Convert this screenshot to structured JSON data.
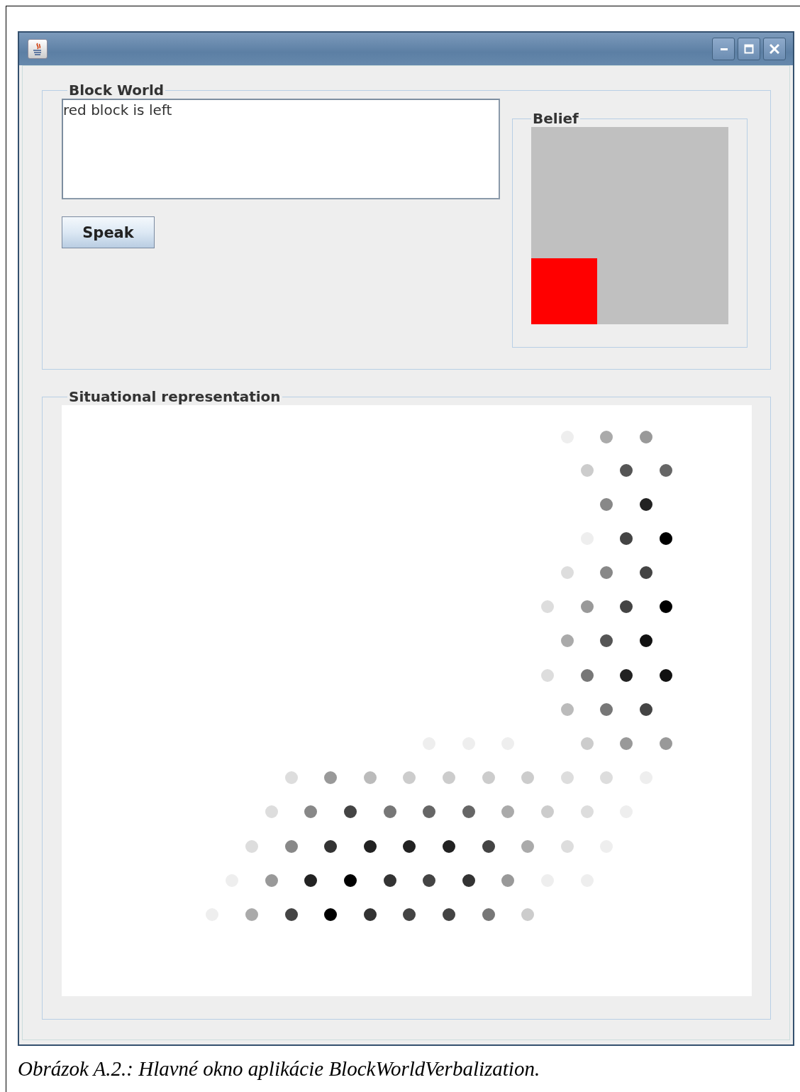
{
  "window": {
    "title_bar_buttons": [
      {
        "kind": "minimize"
      },
      {
        "kind": "maximize"
      },
      {
        "kind": "close"
      }
    ]
  },
  "block_world": {
    "title": "Block World",
    "text_area": {
      "value": "red block is left"
    },
    "speak_button": {
      "label": "Speak"
    },
    "belief": {
      "title": "Belief",
      "cells": [
        {
          "color": "#c0c0c0"
        },
        {
          "color": "#c0c0c0"
        },
        {
          "color": "#c0c0c0"
        },
        {
          "color": "#c0c0c0"
        },
        {
          "color": "#c0c0c0"
        },
        {
          "color": "#c0c0c0"
        },
        {
          "color": "#ff0000"
        },
        {
          "color": "#c0c0c0"
        },
        {
          "color": "#c0c0c0"
        }
      ]
    }
  },
  "situational_representation": {
    "title": "Situational representation"
  },
  "caption": "Obrázok A.2.: Hlavné okno aplikácie BlockWorldVerbalization."
}
